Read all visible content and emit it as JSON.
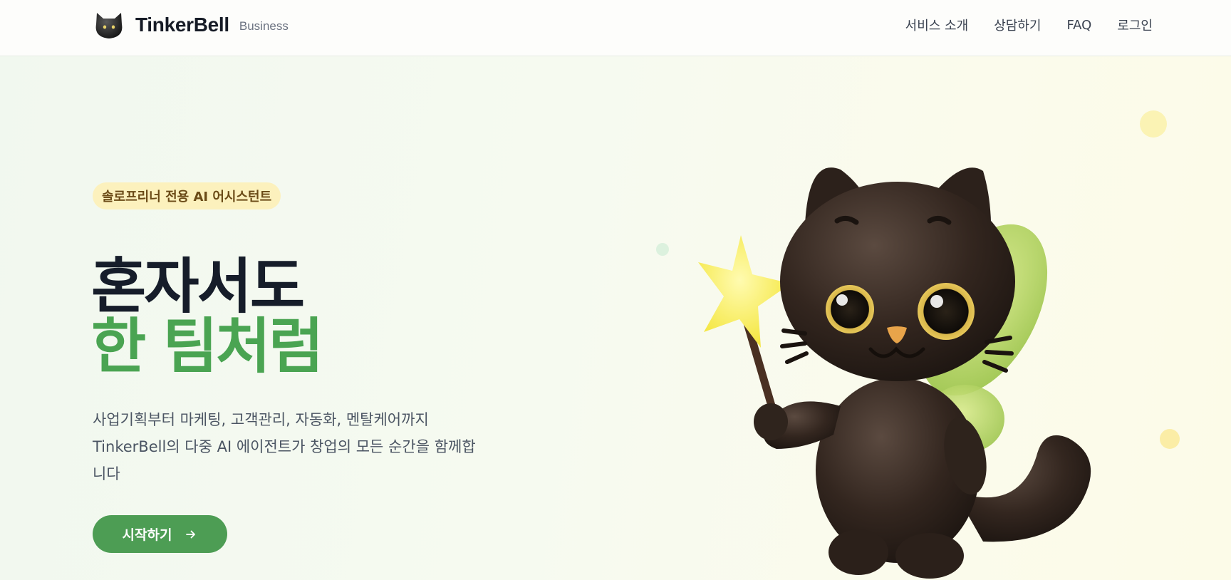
{
  "header": {
    "brand_name": "TinkerBell",
    "brand_tag": "Business",
    "logo_icon": "black-cat-icon",
    "nav": [
      {
        "label": "서비스 소개"
      },
      {
        "label": "상담하기"
      },
      {
        "label": "FAQ"
      },
      {
        "label": "로그인"
      }
    ]
  },
  "hero": {
    "badge": "솔로프리너 전용 AI 어시스턴트",
    "headline_line1": "혼자서도",
    "headline_line2": "한 팀처럼",
    "description_line1": "사업기획부터 마케팅, 고객관리, 자동화, 멘탈케어까지",
    "description_line2": "TinkerBell의 다중 AI 에이전트가 창업의 모든 순간을 함께합",
    "description_line3": "니다",
    "cta_label": "시작하기",
    "cta_icon": "arrow-right-icon",
    "illustration": "fairy-black-cat-with-star-wand"
  },
  "colors": {
    "accent_green": "#4aa452",
    "button_green": "#4d9d54",
    "headline_dark": "#161d2a",
    "badge_bg": "#fcf1bd",
    "badge_text": "#6b4b17"
  }
}
